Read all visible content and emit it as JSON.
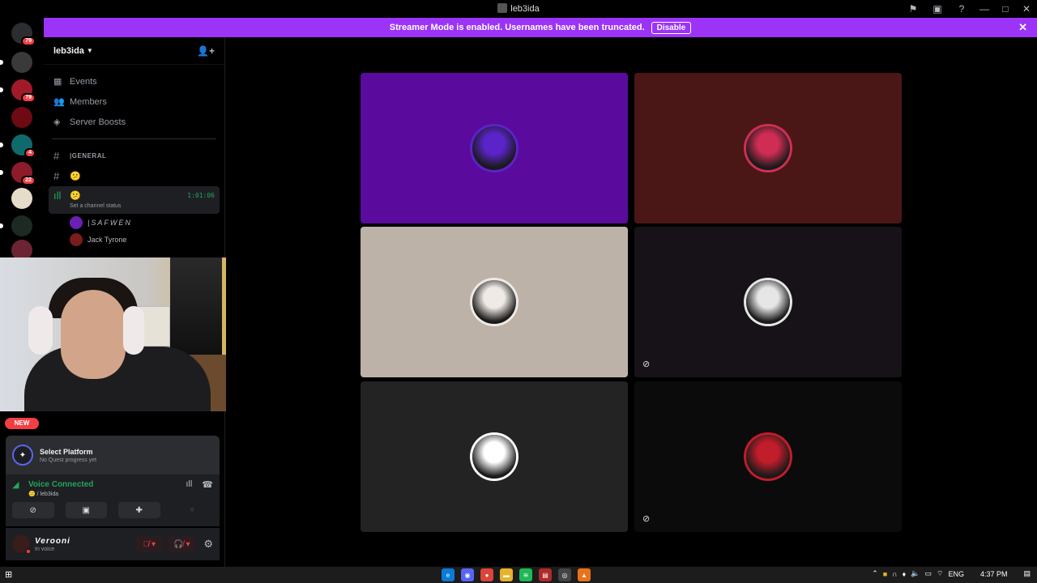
{
  "window": {
    "title": "leb3ida"
  },
  "banner": {
    "text": "Streamer Mode is enabled. Usernames have been truncated.",
    "disable_label": "Disable"
  },
  "guild_badges": [
    "79",
    "79",
    "4",
    "22"
  ],
  "new_badge": "NEW",
  "server": {
    "name": "leb3ida"
  },
  "nav": {
    "events": "Events",
    "members": "Members",
    "boosts": "Server Boosts"
  },
  "channels": {
    "general": "|GENERAL",
    "text2": "😕",
    "voice_name": "😕",
    "voice_timer": "1:01:06",
    "voice_status": "Set a channel status"
  },
  "voice_users": [
    "|SAFWEN",
    "Jack Tyrone"
  ],
  "quest": {
    "title": "Select Platform",
    "subtitle": "No Quest progress yet"
  },
  "voice": {
    "status": "Voice Connected",
    "channel": "😕 / leb3ida"
  },
  "user": {
    "name": "Verooni",
    "status": "In voice"
  },
  "tiles": [
    {
      "bg": "#5a0a9c",
      "ring": "#5a24c8"
    },
    {
      "bg": "#4a1716",
      "ring": "#d02d55"
    },
    {
      "bg": "#bdb2a8",
      "ring": "#efeae5"
    },
    {
      "bg": "#161217",
      "ring": "#e6e6e6"
    },
    {
      "bg": "#232323",
      "ring": "#ffffff"
    },
    {
      "bg": "#0b0b0b",
      "ring": "#c21d2a"
    }
  ],
  "taskbar": {
    "lang": "ENG",
    "time": "4:37 PM"
  },
  "colors": {
    "accent": "#9b34f7",
    "voice_green": "#23a55a",
    "danger": "#f23f43"
  }
}
